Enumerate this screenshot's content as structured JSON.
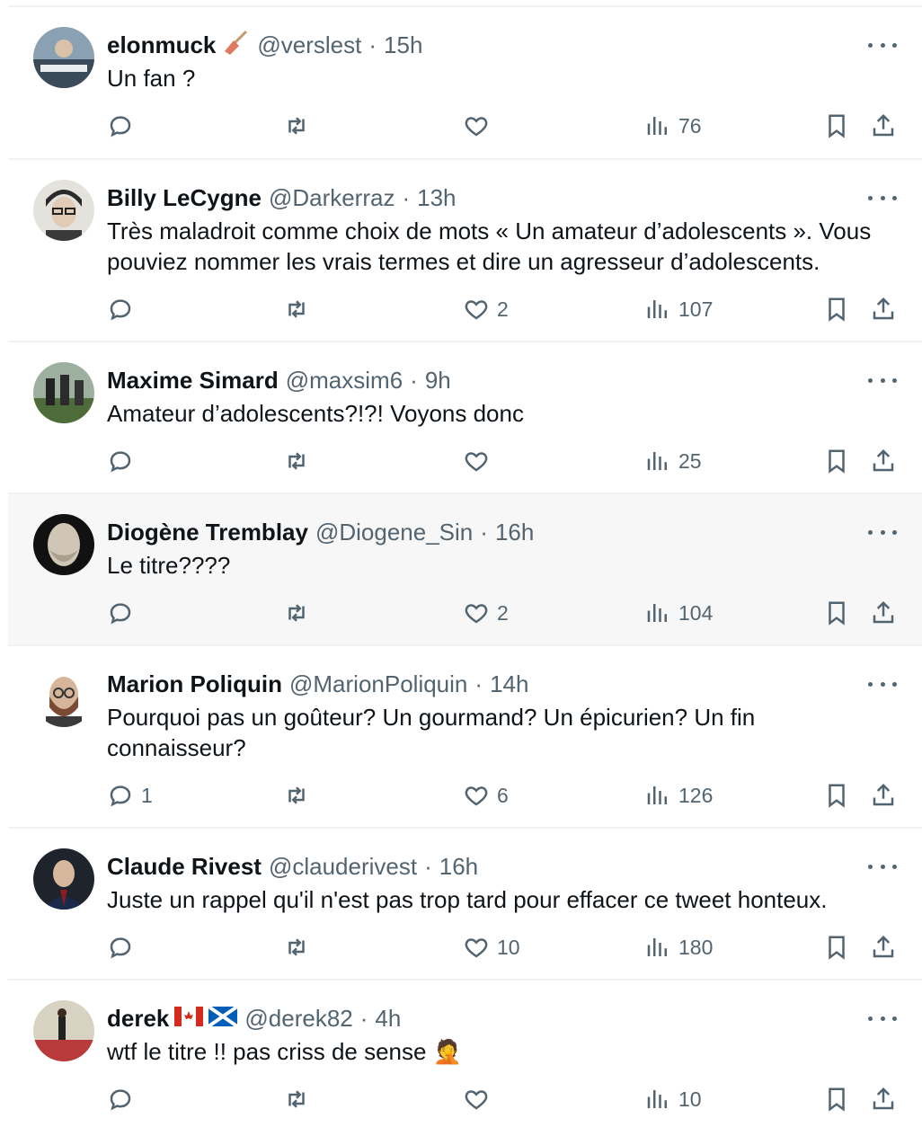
{
  "replies": [
    {
      "name": "elonmuck",
      "handle": "@verslest",
      "time": "15h",
      "text": "Un fan ?",
      "replies": "",
      "retweets": "",
      "likes": "",
      "views": "76",
      "emoji": "broom-emoji",
      "avatar_color": "#7a8ea3",
      "highlight": false
    },
    {
      "name": "Billy LeCygne",
      "handle": "@Darkerraz",
      "time": "13h",
      "text": "Très maladroit comme choix de mots « Un amateur d’adolescents ». Vous pouviez nommer les vrais termes et dire un agresseur d’adolescents.",
      "replies": "",
      "retweets": "",
      "likes": "2",
      "views": "107",
      "avatar_color": "#d9d6cf",
      "highlight": false
    },
    {
      "name": "Maxime Simard",
      "handle": "@maxsim6",
      "time": "9h",
      "text": "Amateur d’adolescents?!?! Voyons donc",
      "replies": "",
      "retweets": "",
      "likes": "",
      "views": "25",
      "avatar_color": "#5e6b4f",
      "highlight": false
    },
    {
      "name": "Diogène Tremblay",
      "handle": "@Diogene_Sin",
      "time": "16h",
      "text": "Le titre????",
      "replies": "",
      "retweets": "",
      "likes": "2",
      "views": "104",
      "avatar_color": "#1a1a1a",
      "highlight": true
    },
    {
      "name": "Marion Poliquin",
      "handle": "@MarionPoliquin",
      "time": "14h",
      "text": "Pourquoi pas un goûteur? Un gourmand? Un épicurien? Un fin connaisseur?",
      "replies": "1",
      "retweets": "",
      "likes": "6",
      "views": "126",
      "avatar_color": "#ffffff",
      "highlight": false
    },
    {
      "name": "Claude Rivest",
      "handle": "@clauderivest",
      "time": "16h",
      "text": "Juste un rappel qu'il n'est pas trop tard pour effacer ce tweet honteux.",
      "replies": "",
      "retweets": "",
      "likes": "10",
      "views": "180",
      "avatar_color": "#2a2f3a",
      "highlight": false
    },
    {
      "name": "derek",
      "handle": "@derek82",
      "time": "4h",
      "text": "wtf le titre !! pas criss de sense 🤦",
      "replies": "",
      "retweets": "",
      "likes": "",
      "views": "10",
      "flags": "canada-flag scotland-flag",
      "avatar_color": "#c8c0a8",
      "highlight": false
    }
  ],
  "separator": "·",
  "colors": {
    "text": "#0f1419",
    "muted": "#536471",
    "border": "#eff3f4",
    "highlight": "#f7f7f7"
  }
}
